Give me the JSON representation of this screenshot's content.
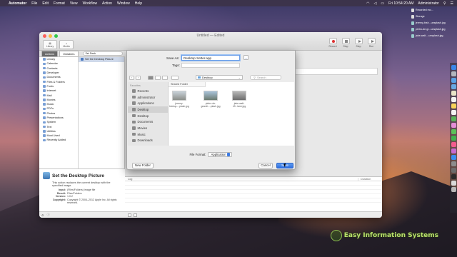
{
  "menubar": {
    "app": "Automator",
    "items": [
      "File",
      "Edit",
      "Format",
      "View",
      "Workflow",
      "Action",
      "Window",
      "Help"
    ],
    "clock": "Fri 10:54:20 AM",
    "user": "Administrator"
  },
  "desktop_files": [
    "Recorded mo...",
    "Storage",
    "jeremy-bish...unsplash.jpg",
    "pietro-de-gr...unsplash.jpg",
    "jake-walt...-unsplash.jpg"
  ],
  "window": {
    "title": "Untitled — Edited",
    "toolbar_left": [
      "Library",
      "Media"
    ],
    "toolbar_right": [
      "Record",
      "Stop",
      "Step",
      "Run"
    ]
  },
  "library": {
    "tabs": [
      "Actions",
      "Variables"
    ],
    "search_value": "Set Desk",
    "items": [
      "Library",
      "Calendar",
      "Contacts",
      "Developer",
      "Documents",
      "Files & Folders",
      "Fonts",
      "Internet",
      "Mail",
      "Movies",
      "Music",
      "PDFs",
      "Photos",
      "Presentations",
      "System",
      "Text",
      "Utilities",
      "Most Used",
      "Recently Added"
    ],
    "actions": [
      "Set the Desktop Picture"
    ]
  },
  "description": {
    "title": "Set the Desktop Picture",
    "text": "This action replaces the current desktop with the specified image.",
    "input_label": "Input:",
    "input_value": "(Files/Folders) image file",
    "result_label": "Result:",
    "result_value": "Files/Folders",
    "version_label": "Version:",
    "version_value": "1.0.2",
    "copyright_label": "Copyright:",
    "copyright_value": "Copyright © 2004–2012 Apple Inc. All rights reserved."
  },
  "log": {
    "col_log": "Log",
    "col_duration": "Duration"
  },
  "save_sheet": {
    "save_as_label": "Save As:",
    "save_as_value": "Desktop Setter.app",
    "tags_label": "Tags:",
    "location": "Desktop",
    "search_placeholder": "Search",
    "sidebar_header": "Favorites",
    "sidebar_items": [
      "Recents",
      "administrator",
      "Applications",
      "Desktop",
      "Documents",
      "Movies",
      "Music",
      "Downloads"
    ],
    "column_header": "Shared Folder",
    "files": [
      "jeremy-bishop-...plash.jpg",
      "pietro-de-grandi-...plash.jpg",
      "jake-walt-49...lash.jpg"
    ],
    "file_format_label": "File Format:",
    "file_format_value": "Application",
    "new_folder": "New Folder",
    "cancel": "Cancel",
    "save": "Save"
  },
  "watermark": "Easy Information Systems",
  "colors": {
    "accent": "#2f6fe0",
    "selection": "#cfd9ea",
    "brand_green": "#b9e06b"
  }
}
